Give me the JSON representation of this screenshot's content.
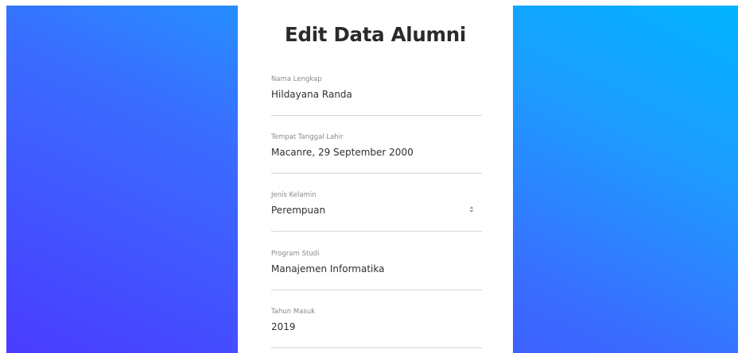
{
  "form": {
    "title": "Edit Data Alumni",
    "fields": [
      {
        "label": "Nama Lengkap",
        "value": "Hildayana Randa",
        "type": "text"
      },
      {
        "label": "Tempat Tanggal Lahir",
        "value": "Macanre, 29 September 2000",
        "type": "text"
      },
      {
        "label": "Jenis Kelamin",
        "value": "Perempuan",
        "type": "select"
      },
      {
        "label": "Program Studi",
        "value": "Manajemen Informatika",
        "type": "text"
      },
      {
        "label": "Tahun Masuk",
        "value": "2019",
        "type": "text"
      }
    ]
  },
  "colors": {
    "gradient_start": "#4a3cff",
    "gradient_end": "#00b3ff",
    "card_background": "#ffffff"
  }
}
